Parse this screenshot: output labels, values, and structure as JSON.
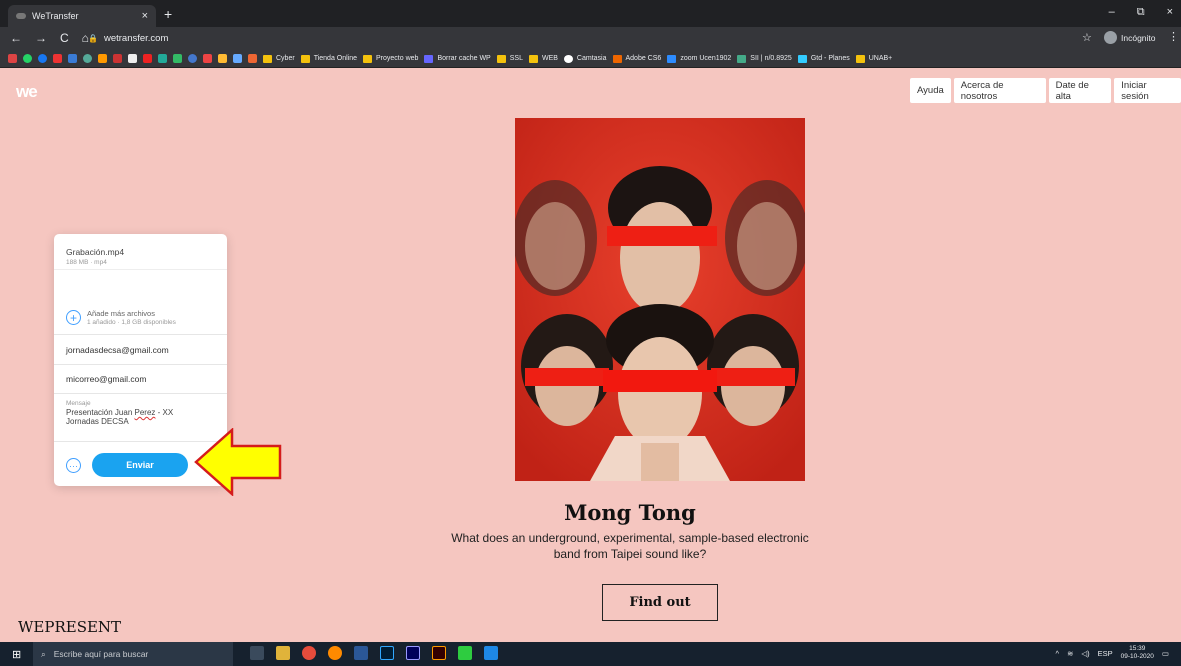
{
  "browser": {
    "tab_title": "WeTransfer",
    "tab_close": "×",
    "new_tab": "+",
    "url": "wetransfer.com",
    "profile_label": "Incógnito",
    "window_controls": [
      "–",
      "⧉",
      "×"
    ],
    "bookmarks": [
      "Cyber",
      "Tienda Online",
      "Proyecto web",
      "Borrar cache WP",
      "SSL",
      "WEB",
      "Camtasia",
      "Adobe CS6",
      "zoom Ucen1902",
      "SII | n/0.8925",
      "Gtd - Planes",
      "UNAB+"
    ]
  },
  "site": {
    "logo": "we",
    "nav": [
      "Ayuda",
      "Acerca de nosotros",
      "Date de alta",
      "Iniciar sesión"
    ]
  },
  "transfer": {
    "file_name": "Grabación.mp4",
    "file_meta": "188 MB · mp4",
    "add_more": "Añade más archivos",
    "add_meta": "1 añadido · 1,8 GB disponibles",
    "to_email": "jornadasdecsa@gmail.com",
    "from_email": "micorreo@gmail.com",
    "message_label": "Mensaje",
    "message_line1_a": "Presentación Juan ",
    "message_line1_b": "Perez",
    "message_line1_c": " - XX",
    "message_line2": "Jornadas DECSA",
    "send_label": "Enviar",
    "more_options": "···"
  },
  "feature": {
    "title": "Mong Tong",
    "subtitle": "What does an underground, experimental, sample-based electronic band from Taipei sound like?",
    "cta": "Find out",
    "brand": "WEPRESENT"
  },
  "taskbar": {
    "search_placeholder": "Escribe aquí para buscar",
    "lang": "ESP",
    "time": "15:39",
    "date": "09-10-2020"
  }
}
